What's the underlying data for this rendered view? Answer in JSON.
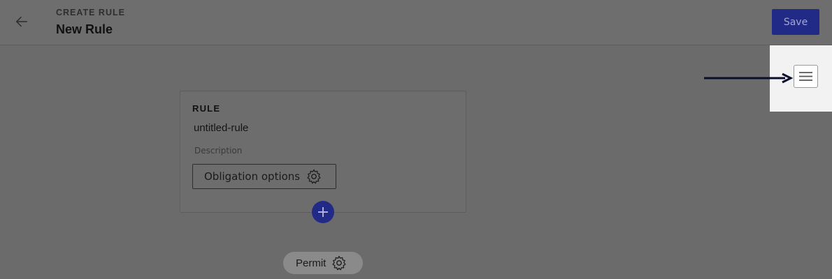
{
  "header": {
    "subtitle": "CREATE RULE",
    "title": "New Rule",
    "back_icon": "arrow-left-icon",
    "save_label": "Save"
  },
  "sidebar_toggle": {
    "icon": "hamburger-menu-icon"
  },
  "rule_card": {
    "heading": "RULE",
    "name": "untitled-rule",
    "description_placeholder": "Description",
    "obligation_label": "Obligation options",
    "obligation_icon": "gear-icon"
  },
  "add_button": {
    "icon": "plus-icon"
  },
  "effect": {
    "label": "Permit",
    "icon": "gear-icon"
  },
  "colors": {
    "overlay": "#6b6b6b",
    "primary": "#222a88",
    "highlight": "#f2f2f2",
    "arrow": "#0b0d2e"
  }
}
